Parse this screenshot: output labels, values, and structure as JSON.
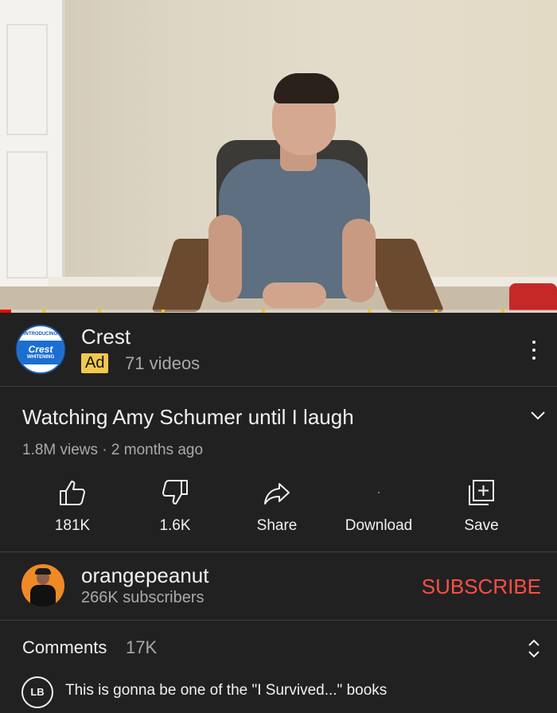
{
  "video": {
    "progress_fraction": 0.02,
    "ad_marker_fractions": [
      0.075,
      0.175,
      0.29,
      0.47,
      0.66,
      0.78,
      0.9
    ]
  },
  "ad": {
    "logo_text_top": "INTRODUCING",
    "logo_brand": "Crest",
    "logo_text_bottom": "WHITENING",
    "name": "Crest",
    "badge": "Ad",
    "video_count": "71 videos"
  },
  "video_info": {
    "title": "Watching Amy Schumer until I laugh",
    "meta": "1.8M views · 2 months ago"
  },
  "actions": [
    {
      "label": "181K",
      "icon": "thumbs-up-icon"
    },
    {
      "label": "1.6K",
      "icon": "thumbs-down-icon"
    },
    {
      "label": "Share",
      "icon": "share-icon"
    },
    {
      "label": "Download",
      "icon": "download-icon"
    },
    {
      "label": "Save",
      "icon": "save-playlist-icon"
    }
  ],
  "channel": {
    "name": "orangepeanut",
    "subscribers": "266K subscribers",
    "subscribe_label": "SUBSCRIBE"
  },
  "comments": {
    "title": "Comments",
    "count": "17K",
    "commenter_initials": "LB",
    "top_comment": "This is gonna be one of the \"I Survived...\" books"
  },
  "colors": {
    "background": "#212121",
    "subscribe": "#ff4e45",
    "ad_badge": "#f2c84b",
    "progress": "#ff0000"
  }
}
